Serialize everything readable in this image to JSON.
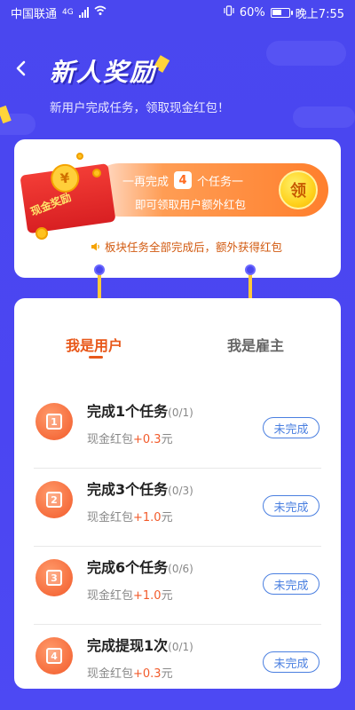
{
  "status_bar": {
    "carrier": "中国联通",
    "network": "4G",
    "battery": "60%",
    "time": "晚上7:55"
  },
  "header": {
    "title": "新人奖励",
    "subtitle": "新用户完成任务，领取现金红包！"
  },
  "reward_banner": {
    "envelope_label": "现金奖励",
    "envelope_seal": "¥",
    "line1_prefix": "一再完成",
    "task_count": "4",
    "line1_suffix": "个任务一",
    "line2": "即可领取用户额外红包",
    "claim_label": "领",
    "notice": "板块任务全部完成后，额外获得红包"
  },
  "tabs": [
    {
      "label": "我是用户",
      "active": true
    },
    {
      "label": "我是雇主",
      "active": false
    }
  ],
  "tasks": [
    {
      "icon_num": "1",
      "title": "完成1个任务",
      "progress": "(0/1)",
      "reward_label": "现金红包",
      "reward_amount": "+0.3",
      "reward_unit": "元",
      "status": "未完成"
    },
    {
      "icon_num": "2",
      "title": "完成3个任务",
      "progress": "(0/3)",
      "reward_label": "现金红包",
      "reward_amount": "+1.0",
      "reward_unit": "元",
      "status": "未完成"
    },
    {
      "icon_num": "3",
      "title": "完成6个任务",
      "progress": "(0/6)",
      "reward_label": "现金红包",
      "reward_amount": "+1.0",
      "reward_unit": "元",
      "status": "未完成"
    },
    {
      "icon_num": "4",
      "title": "完成提现1次",
      "progress": "(0/1)",
      "reward_label": "现金红包",
      "reward_amount": "+0.3",
      "reward_unit": "元",
      "status": "未完成"
    }
  ],
  "colors": {
    "background": "#4a47ef",
    "accent_orange": "#e8581a",
    "status_blue": "#4a7fe0",
    "gold": "#ffc93a"
  }
}
